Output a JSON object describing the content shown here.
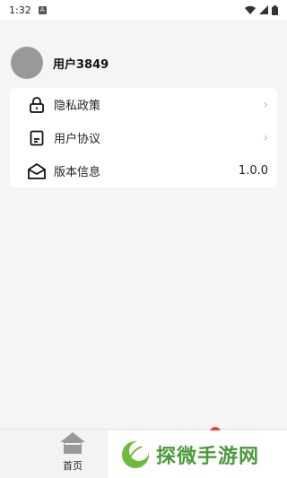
{
  "status_bar": {
    "time": "1:32",
    "notif_icon": "A"
  },
  "profile": {
    "username": "用户3849"
  },
  "menu": [
    {
      "label": "隐私政策",
      "icon": "lock-icon",
      "right": "›"
    },
    {
      "label": "用户协议",
      "icon": "document-icon",
      "right": "›"
    },
    {
      "label": "版本信息",
      "icon": "envelope-open-icon",
      "right": "1.0.0"
    }
  ],
  "bottom_nav": {
    "home_label": "首页"
  },
  "watermark": {
    "text": "探微手游网"
  },
  "colors": {
    "background": "#f5f5f5",
    "card": "#ffffff",
    "avatar": "#999999",
    "watermark": "#4a9a3a"
  }
}
